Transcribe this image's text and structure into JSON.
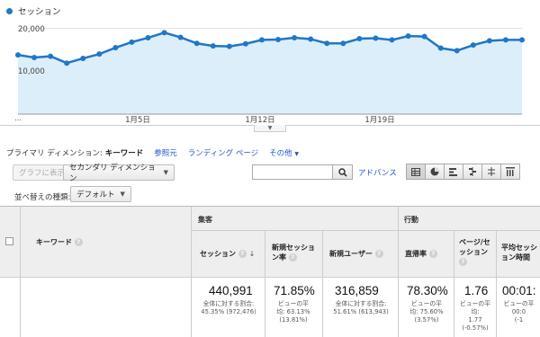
{
  "legend": {
    "label": "セッション",
    "color": "#1f77c8"
  },
  "chart_data": {
    "type": "area",
    "series": [
      {
        "name": "セッション",
        "values": [
          13800,
          13200,
          13500,
          11900,
          13000,
          14000,
          15500,
          16800,
          17800,
          19000,
          17900,
          16500,
          15900,
          15800,
          16400,
          17300,
          17400,
          17800,
          17500,
          16500,
          16500,
          17600,
          17700,
          17300,
          18200,
          18100,
          15400,
          14800,
          16100,
          17100,
          17300,
          17300
        ]
      }
    ],
    "ylim": [
      0,
      22000
    ],
    "yticks": [
      "20,000",
      "10,000"
    ],
    "xticks": [
      "…",
      "1月5日",
      "1月12日",
      "1月19日"
    ],
    "grid": true,
    "color": "#1f77c8"
  },
  "dimension_bar": {
    "primary_label": "プライマリ ディメンション:",
    "active": "キーワード",
    "links": [
      "参照元",
      "ランディング ページ",
      "その他"
    ]
  },
  "toolbar": {
    "graph_button": "グラフに表示",
    "secondary_dim": "セカンダリ ディメンション",
    "search_placeholder": "",
    "advanced": "アドバンス",
    "sort_label": "並べ替えの種類:",
    "sort_value": "デフォルト"
  },
  "view_icons": [
    "table-view-icon",
    "pie-view-icon",
    "bar-view-icon",
    "comparison-view-icon",
    "pivot-view-icon",
    "term-cloud-icon"
  ],
  "table": {
    "keyword_header": "キーワード",
    "groups": [
      "集客",
      "行動"
    ],
    "columns": [
      {
        "label": "セッション",
        "sub": ""
      },
      {
        "label": "新規セッション率",
        "sub": ""
      },
      {
        "label": "新規ユーザー",
        "sub": ""
      },
      {
        "label": "直帰率",
        "sub": ""
      },
      {
        "label": "ページ/セッション",
        "sub": ""
      },
      {
        "label": "平均セッション時間",
        "sub": ""
      }
    ],
    "totals": [
      {
        "value": "440,991",
        "line1": "全体に対する割合:",
        "line2": "45.35% (972,476)"
      },
      {
        "value": "71.85%",
        "line1": "ビューの平",
        "line2": "均: 63.13%",
        "line3": "(13.81%)"
      },
      {
        "value": "316,859",
        "line1": "全体に対する割合:",
        "line2": "51.61% (613,943)"
      },
      {
        "value": "78.30%",
        "line1": "ビューの平",
        "line2": "均: 75.60%",
        "line3": "(3.57%)"
      },
      {
        "value": "1.76",
        "line1": "ビューの平",
        "line2": "均:",
        "line3": "1.77",
        "line4": "(-0.57%)"
      },
      {
        "value": "00:01:",
        "line1": "ビューの平",
        "line2": "00:0",
        "line3": "(-1"
      }
    ]
  }
}
